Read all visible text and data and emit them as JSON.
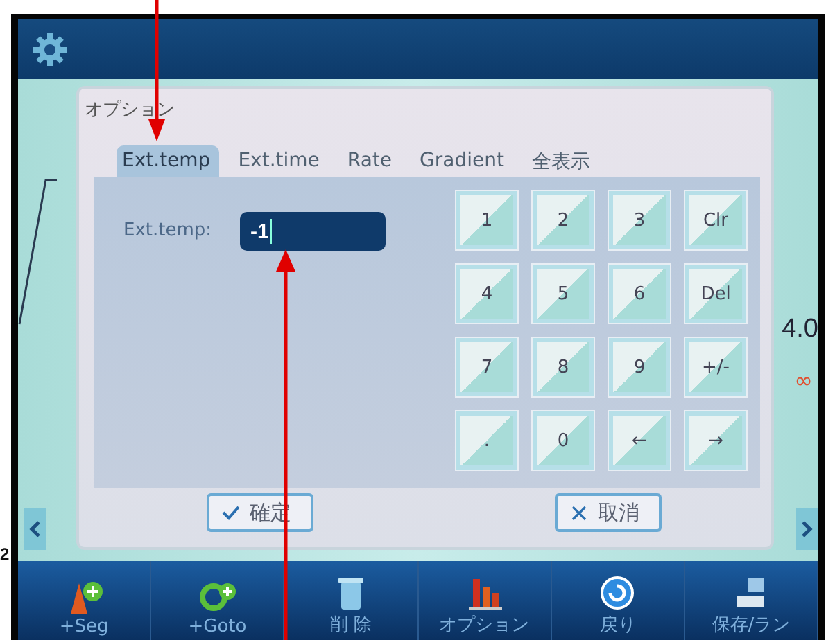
{
  "dialog": {
    "title": "オプション"
  },
  "tabs": [
    {
      "label": "Ext.temp",
      "selected": true
    },
    {
      "label": "Ext.time",
      "selected": false
    },
    {
      "label": "Rate",
      "selected": false
    },
    {
      "label": "Gradient",
      "selected": false
    },
    {
      "label": "全表示",
      "selected": false
    }
  ],
  "field": {
    "label": "Ext.temp:",
    "value": "-1"
  },
  "keypad": [
    [
      "1",
      "2",
      "3",
      "Clr"
    ],
    [
      "4",
      "5",
      "6",
      "Del"
    ],
    [
      "7",
      "8",
      "9",
      "+/-"
    ],
    [
      ".",
      "0",
      "←",
      "→"
    ]
  ],
  "dialog_buttons": [
    {
      "kind": "confirm",
      "label": "確定"
    },
    {
      "kind": "cancel",
      "label": "取消"
    }
  ],
  "background": {
    "reading": "4.0",
    "symbol": "∞"
  },
  "toolbar": [
    {
      "kind": "segment",
      "label": "+Seg"
    },
    {
      "kind": "goto",
      "label": "+Goto"
    },
    {
      "kind": "delete",
      "label": "削 除"
    },
    {
      "kind": "options",
      "label": "オプション"
    },
    {
      "kind": "back",
      "label": "戻り"
    },
    {
      "kind": "save",
      "label": "保存/ラン"
    }
  ],
  "side_text": "2"
}
